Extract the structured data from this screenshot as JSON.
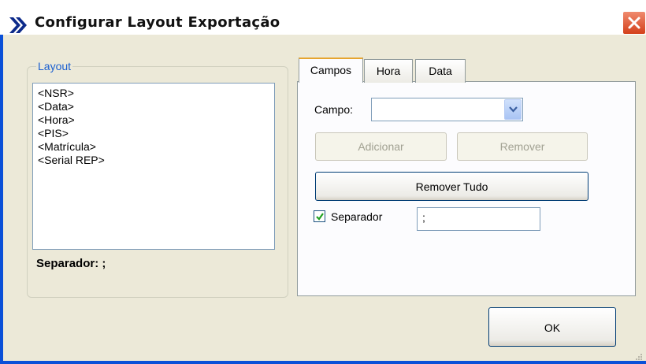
{
  "window": {
    "title": "Configurar Layout Exportação",
    "close_icon": "close-icon"
  },
  "layout_group": {
    "legend": "Layout",
    "items": [
      "<NSR>",
      "<Data>",
      "<Hora>",
      "<PIS>",
      "<Matrícula>",
      "<Serial REP>"
    ],
    "separator_text": "Separador: ;"
  },
  "tabs": [
    {
      "label": "Campos",
      "active": true
    },
    {
      "label": "Hora",
      "active": false
    },
    {
      "label": "Data",
      "active": false
    }
  ],
  "campos": {
    "campo_label": "Campo:",
    "campo_value": "",
    "add_label": "Adicionar",
    "remove_label": "Remover",
    "remove_all_label": "Remover Tudo",
    "separator_checkbox_label": "Separador",
    "separator_checked": true,
    "separator_value": ";"
  },
  "ok_label": "OK",
  "colors": {
    "title_bar_border": "#0a50d8",
    "dialog_bg": "#ece9d8",
    "legend_text": "#1a5fd0",
    "active_tab_accent": "#e6a530",
    "close_button": "#d4401a"
  }
}
